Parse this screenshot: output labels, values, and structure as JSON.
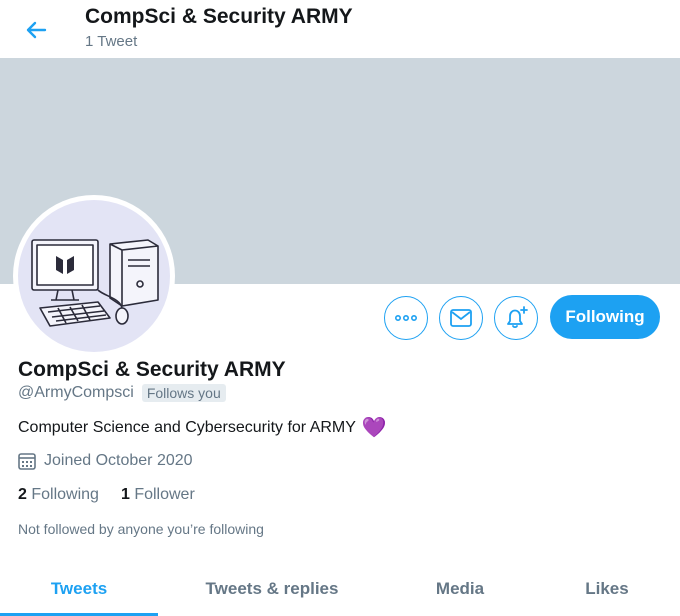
{
  "header": {
    "title": "CompSci & Security ARMY",
    "tweet_count": "1 Tweet"
  },
  "profile": {
    "display_name": "CompSci & Security ARMY",
    "handle": "@ArmyCompsci",
    "follows_you": "Follows you",
    "bio": "Computer Science and Cybersecurity for ARMY",
    "bio_emoji": "💜",
    "joined": "Joined October 2020",
    "following_count": "2",
    "following_label": "Following",
    "followers_count": "1",
    "followers_label": "Follower",
    "not_followed": "Not followed by anyone you’re following"
  },
  "actions": {
    "follow_label": "Following"
  },
  "tabs": [
    {
      "label": "Tweets"
    },
    {
      "label": "Tweets & replies"
    },
    {
      "label": "Media"
    },
    {
      "label": "Likes"
    }
  ],
  "colors": {
    "accent": "#1da1f2",
    "banner": "#ccd6dd",
    "heart": "#a77fd6"
  },
  "icons": [
    "back-arrow-icon",
    "more-icon",
    "mail-icon",
    "bell-plus-icon",
    "calendar-icon"
  ]
}
